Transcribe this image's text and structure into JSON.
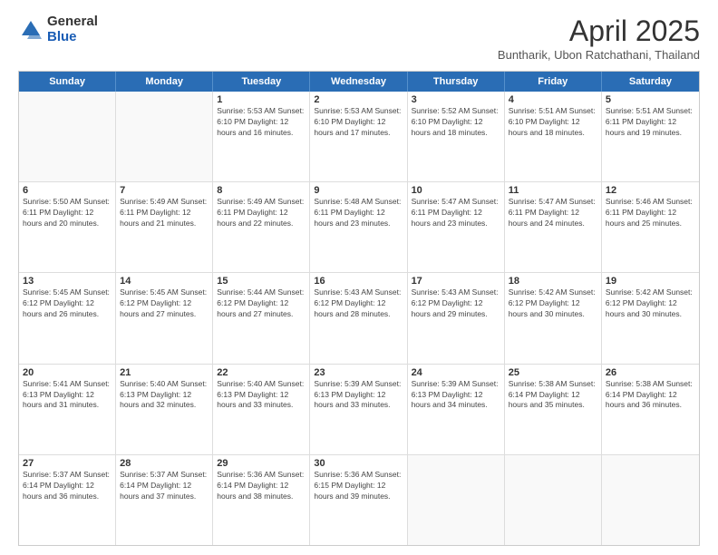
{
  "logo": {
    "general": "General",
    "blue": "Blue"
  },
  "title": {
    "month": "April 2025",
    "location": "Buntharik, Ubon Ratchathani, Thailand"
  },
  "days_of_week": [
    "Sunday",
    "Monday",
    "Tuesday",
    "Wednesday",
    "Thursday",
    "Friday",
    "Saturday"
  ],
  "weeks": [
    [
      {
        "day": "",
        "info": ""
      },
      {
        "day": "",
        "info": ""
      },
      {
        "day": "1",
        "info": "Sunrise: 5:53 AM\nSunset: 6:10 PM\nDaylight: 12 hours and 16 minutes."
      },
      {
        "day": "2",
        "info": "Sunrise: 5:53 AM\nSunset: 6:10 PM\nDaylight: 12 hours and 17 minutes."
      },
      {
        "day": "3",
        "info": "Sunrise: 5:52 AM\nSunset: 6:10 PM\nDaylight: 12 hours and 18 minutes."
      },
      {
        "day": "4",
        "info": "Sunrise: 5:51 AM\nSunset: 6:10 PM\nDaylight: 12 hours and 18 minutes."
      },
      {
        "day": "5",
        "info": "Sunrise: 5:51 AM\nSunset: 6:11 PM\nDaylight: 12 hours and 19 minutes."
      }
    ],
    [
      {
        "day": "6",
        "info": "Sunrise: 5:50 AM\nSunset: 6:11 PM\nDaylight: 12 hours and 20 minutes."
      },
      {
        "day": "7",
        "info": "Sunrise: 5:49 AM\nSunset: 6:11 PM\nDaylight: 12 hours and 21 minutes."
      },
      {
        "day": "8",
        "info": "Sunrise: 5:49 AM\nSunset: 6:11 PM\nDaylight: 12 hours and 22 minutes."
      },
      {
        "day": "9",
        "info": "Sunrise: 5:48 AM\nSunset: 6:11 PM\nDaylight: 12 hours and 23 minutes."
      },
      {
        "day": "10",
        "info": "Sunrise: 5:47 AM\nSunset: 6:11 PM\nDaylight: 12 hours and 23 minutes."
      },
      {
        "day": "11",
        "info": "Sunrise: 5:47 AM\nSunset: 6:11 PM\nDaylight: 12 hours and 24 minutes."
      },
      {
        "day": "12",
        "info": "Sunrise: 5:46 AM\nSunset: 6:11 PM\nDaylight: 12 hours and 25 minutes."
      }
    ],
    [
      {
        "day": "13",
        "info": "Sunrise: 5:45 AM\nSunset: 6:12 PM\nDaylight: 12 hours and 26 minutes."
      },
      {
        "day": "14",
        "info": "Sunrise: 5:45 AM\nSunset: 6:12 PM\nDaylight: 12 hours and 27 minutes."
      },
      {
        "day": "15",
        "info": "Sunrise: 5:44 AM\nSunset: 6:12 PM\nDaylight: 12 hours and 27 minutes."
      },
      {
        "day": "16",
        "info": "Sunrise: 5:43 AM\nSunset: 6:12 PM\nDaylight: 12 hours and 28 minutes."
      },
      {
        "day": "17",
        "info": "Sunrise: 5:43 AM\nSunset: 6:12 PM\nDaylight: 12 hours and 29 minutes."
      },
      {
        "day": "18",
        "info": "Sunrise: 5:42 AM\nSunset: 6:12 PM\nDaylight: 12 hours and 30 minutes."
      },
      {
        "day": "19",
        "info": "Sunrise: 5:42 AM\nSunset: 6:12 PM\nDaylight: 12 hours and 30 minutes."
      }
    ],
    [
      {
        "day": "20",
        "info": "Sunrise: 5:41 AM\nSunset: 6:13 PM\nDaylight: 12 hours and 31 minutes."
      },
      {
        "day": "21",
        "info": "Sunrise: 5:40 AM\nSunset: 6:13 PM\nDaylight: 12 hours and 32 minutes."
      },
      {
        "day": "22",
        "info": "Sunrise: 5:40 AM\nSunset: 6:13 PM\nDaylight: 12 hours and 33 minutes."
      },
      {
        "day": "23",
        "info": "Sunrise: 5:39 AM\nSunset: 6:13 PM\nDaylight: 12 hours and 33 minutes."
      },
      {
        "day": "24",
        "info": "Sunrise: 5:39 AM\nSunset: 6:13 PM\nDaylight: 12 hours and 34 minutes."
      },
      {
        "day": "25",
        "info": "Sunrise: 5:38 AM\nSunset: 6:14 PM\nDaylight: 12 hours and 35 minutes."
      },
      {
        "day": "26",
        "info": "Sunrise: 5:38 AM\nSunset: 6:14 PM\nDaylight: 12 hours and 36 minutes."
      }
    ],
    [
      {
        "day": "27",
        "info": "Sunrise: 5:37 AM\nSunset: 6:14 PM\nDaylight: 12 hours and 36 minutes."
      },
      {
        "day": "28",
        "info": "Sunrise: 5:37 AM\nSunset: 6:14 PM\nDaylight: 12 hours and 37 minutes."
      },
      {
        "day": "29",
        "info": "Sunrise: 5:36 AM\nSunset: 6:14 PM\nDaylight: 12 hours and 38 minutes."
      },
      {
        "day": "30",
        "info": "Sunrise: 5:36 AM\nSunset: 6:15 PM\nDaylight: 12 hours and 39 minutes."
      },
      {
        "day": "",
        "info": ""
      },
      {
        "day": "",
        "info": ""
      },
      {
        "day": "",
        "info": ""
      }
    ]
  ]
}
